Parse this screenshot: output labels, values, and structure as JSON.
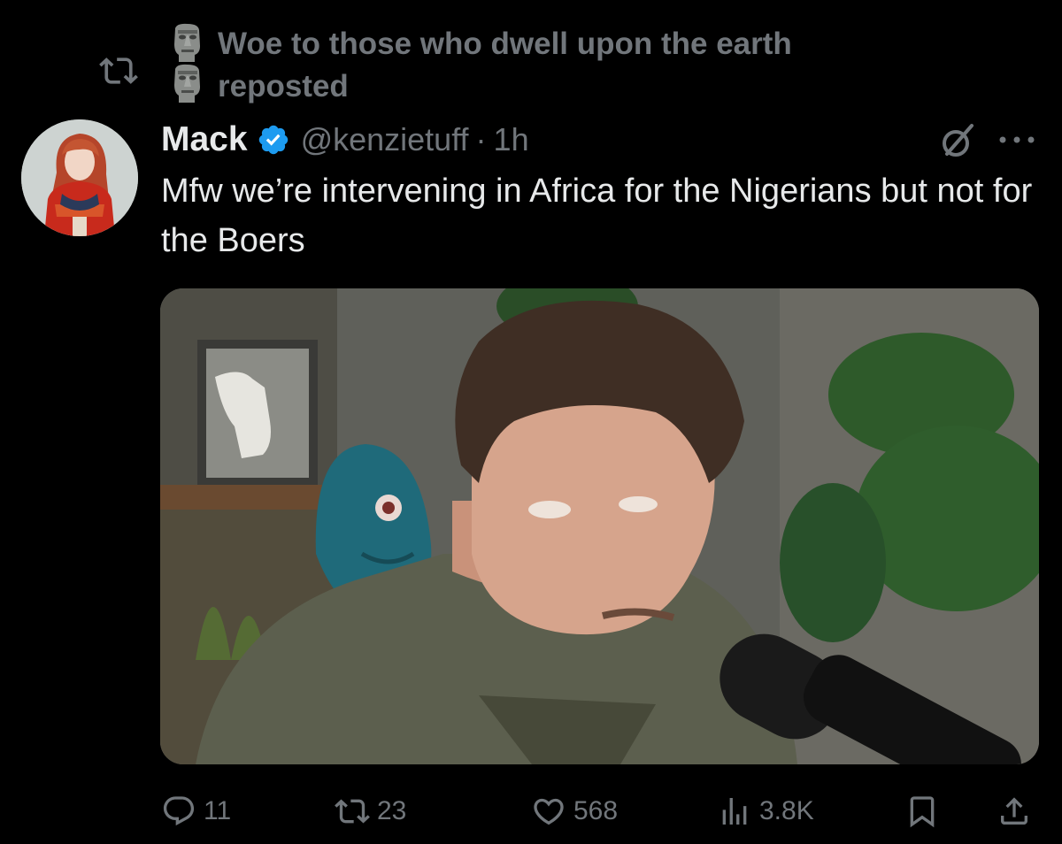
{
  "repost": {
    "line1": "Woe to those who dwell upon the earth",
    "line2": "reposted"
  },
  "tweet": {
    "display_name": "Mack",
    "handle": "@kenzietuff",
    "separator": "·",
    "time": "1h",
    "text": "Mfw we’re intervening in Africa for the Nigerians but not for the Boers"
  },
  "actions": {
    "replies": "11",
    "reposts": "23",
    "likes": "568",
    "views": "3.8K"
  },
  "colors": {
    "background": "#000000",
    "text_primary": "#e7e9ea",
    "text_secondary": "#71767b",
    "verified_blue": "#1d9bf0"
  },
  "icons": {
    "repost": "repost-icon",
    "verified": "verified-badge-icon",
    "grok": "grok-icon",
    "more": "more-options-icon",
    "reply": "reply-icon",
    "retweet": "retweet-icon",
    "like": "heart-icon",
    "views": "views-icon",
    "bookmark": "bookmark-icon",
    "share": "share-icon"
  }
}
